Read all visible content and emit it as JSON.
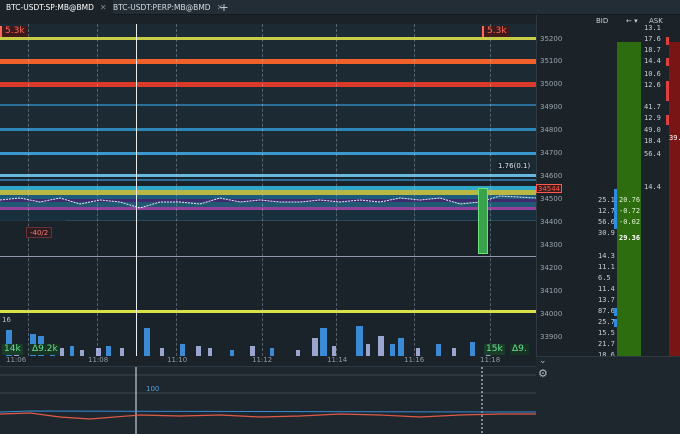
{
  "tabs": [
    {
      "label": "BTC-USDT:SP:MB@BMD",
      "active": true
    },
    {
      "label": "BTC-USDT:PERP:MB@BMD",
      "active": false
    }
  ],
  "tab_close_glyph": "✕",
  "tab_add_glyph": "+",
  "chart": {
    "level_tag_left": "5.3k",
    "level_tag_right": "5.3k",
    "order_tag": "-40/2",
    "crosshair_value": "1.76(0.1)",
    "volume_scale_label": "16",
    "vol_left": "14k",
    "delta_left": "Δ9.2k",
    "vol_right": "15k",
    "delta_right": "Δ9.",
    "current_price": "34544"
  },
  "price_axis": [
    "35200",
    "35100",
    "35000",
    "34900",
    "34800",
    "34700",
    "34600",
    "34500",
    "34400",
    "34300",
    "34200",
    "34100",
    "34000",
    "33900"
  ],
  "time_axis": [
    "11:06",
    "11:08",
    "11:10",
    "11:12",
    "11:14",
    "11:16",
    "11:18"
  ],
  "indicator": {
    "label": "100"
  },
  "dom": {
    "bid_header": "BID",
    "ask_header": "ASK",
    "header_icons": "← ▾",
    "ask_values": [
      "13.1",
      "17.6",
      "18.7",
      "14.4",
      "10.6",
      "12.6",
      "41.7",
      "12.9",
      "49.0",
      "18.4",
      "56.4",
      "14.4"
    ],
    "ask_markers": [
      "",
      "",
      "",
      "",
      "",
      "",
      "",
      "",
      "",
      "",
      "39.",
      ""
    ],
    "bid_values": [
      "25.1",
      "12.7",
      "56.6",
      "30.9",
      "14.3",
      "11.1",
      "6.5",
      "11.4",
      "13.7",
      "87.6",
      "25.7",
      "15.5",
      "21.7",
      "18.6"
    ],
    "delta_values": [
      "20.76",
      "-0.72",
      "-0.02",
      "29.36"
    ],
    "gear_icon": "⚙",
    "chevron_icon": "⌄"
  },
  "colors": {
    "bid_column": "#2e6c10",
    "ask_column": "#7a1515",
    "accent_red": "#ff5a4d",
    "accent_green": "#6be08f"
  }
}
